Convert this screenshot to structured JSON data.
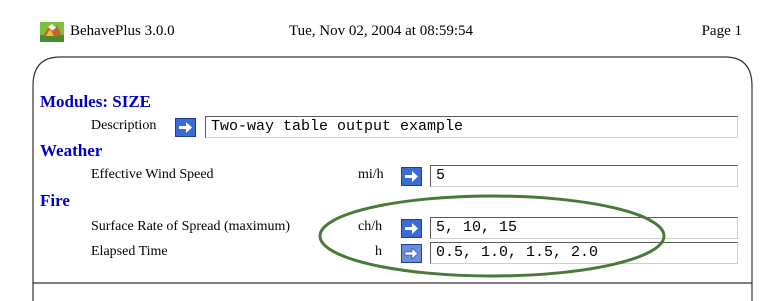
{
  "header": {
    "app_title": "BehavePlus 3.0.0",
    "date": "Tue, Nov 02, 2004 at 08:59:54",
    "page": "Page 1",
    "logo_icon": "behaveplus-logo-icon"
  },
  "modules": {
    "title": "Modules: SIZE",
    "description_label": "Description",
    "description_value": "Two-way table output example"
  },
  "weather": {
    "title": "Weather",
    "wind_label": "Effective Wind Speed",
    "wind_unit": "mi/h",
    "wind_value": "5"
  },
  "fire": {
    "title": "Fire",
    "ros_label": "Surface Rate of Spread (maximum)",
    "ros_unit": "ch/h",
    "ros_value": "5, 10, 15",
    "elapsed_label": "Elapsed Time",
    "elapsed_unit": "h",
    "elapsed_value": "0.5, 1.0, 1.5, 2.0"
  },
  "colors": {
    "section_title": "#0000cc",
    "arrow_button": "#3a6bd6",
    "annotation_ellipse": "#4a7a3a"
  }
}
